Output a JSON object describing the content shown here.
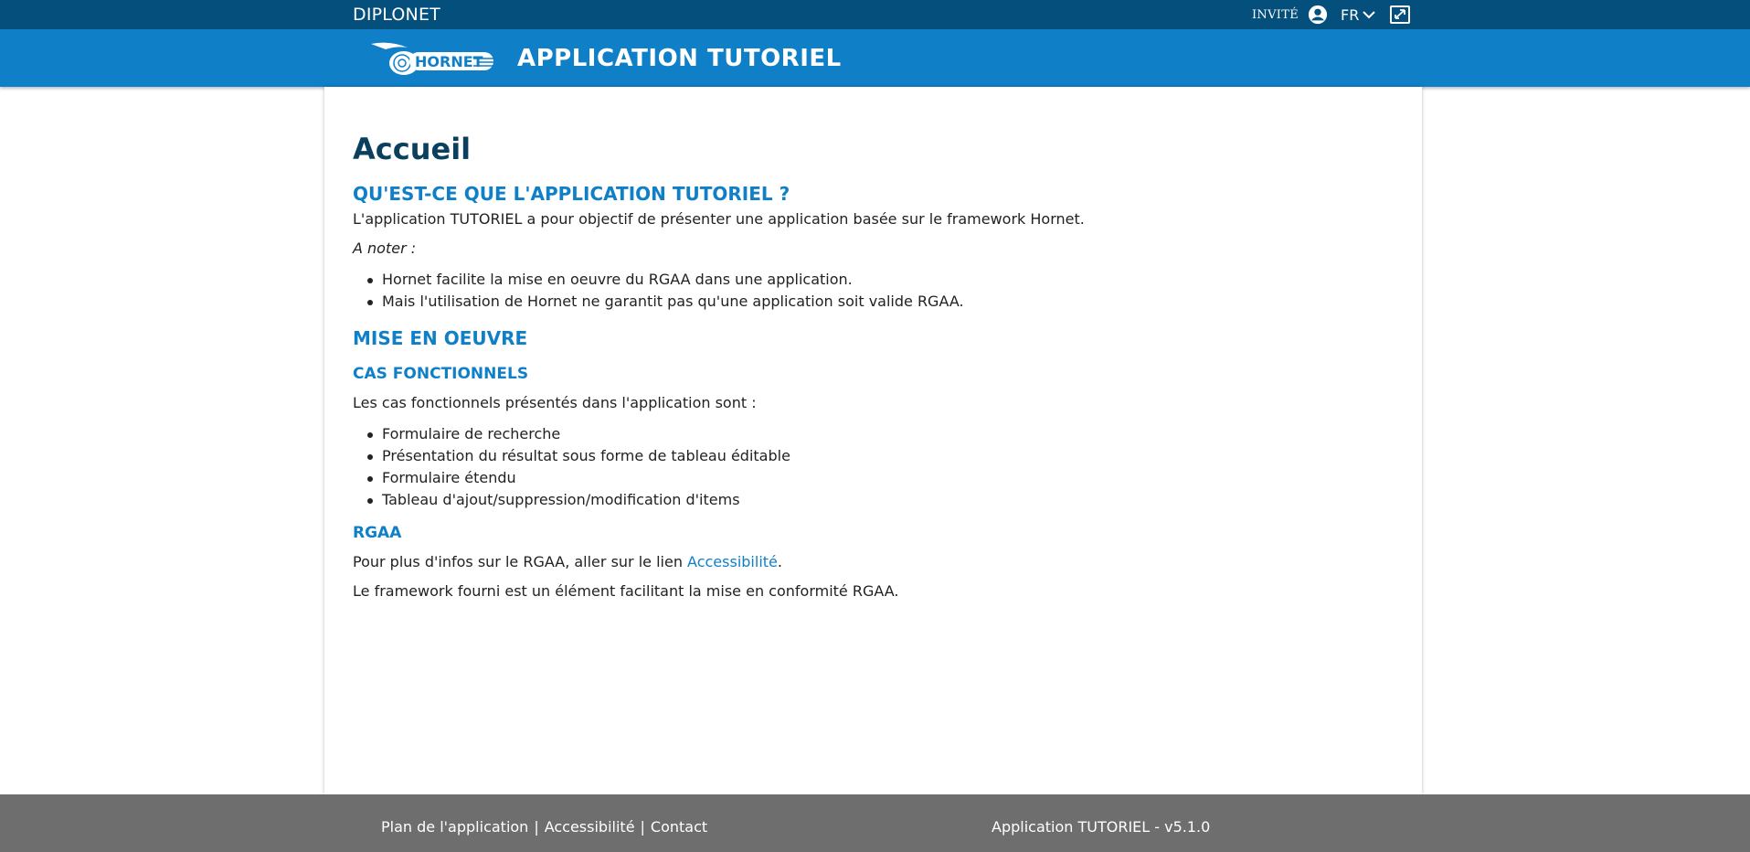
{
  "topbar": {
    "brand": "DIPLONET",
    "user_label": "INVITÉ",
    "language": "FR",
    "icons": [
      "user-circle-icon",
      "chevron-down-icon",
      "fullscreen-icon"
    ],
    "color": "#054f7c"
  },
  "appbar": {
    "logo_text": "HORNET",
    "title": "APPLICATION TUTORIEL",
    "color": "#0f7fc8"
  },
  "main": {
    "page_title": "Accueil",
    "section1": {
      "heading": "QU'EST-CE QUE L'APPLICATION TUTORIEL ?",
      "intro": "L'application TUTORIEL a pour objectif de présenter une application basée sur le framework Hornet.",
      "note": "A noter :",
      "items": [
        "Hornet facilite la mise en oeuvre du RGAA dans une application.",
        "Mais l'utilisation de Hornet ne garantit pas qu'une application soit valide RGAA."
      ]
    },
    "section2": {
      "heading": "MISE EN OEUVRE",
      "sub1": {
        "heading": "CAS FONCTIONNELS",
        "intro": "Les cas fonctionnels présentés dans l'application sont :",
        "items": [
          "Formulaire de recherche",
          "Présentation du résultat sous forme de tableau éditable",
          "Formulaire étendu",
          "Tableau d'ajout/suppression/modification d'items"
        ]
      },
      "sub2": {
        "heading": "RGAA",
        "text_before": "Pour plus d'infos sur le RGAA, aller sur le lien ",
        "link": "Accessibilité",
        "text_after": ".",
        "text2": "Le framework fourni est un élément facilitant la mise en conformité RGAA."
      }
    }
  },
  "footer": {
    "links": [
      "Plan de l'application",
      "Accessibilité",
      "Contact"
    ],
    "separator": "|",
    "version": "Application TUTORIEL - v5.1.0",
    "color": "#6e6e6e"
  }
}
